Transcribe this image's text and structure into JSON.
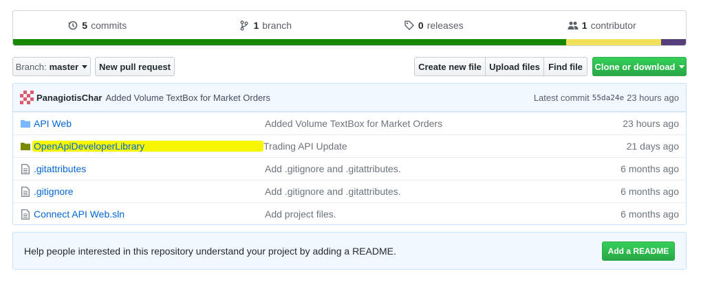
{
  "summary": {
    "commits": {
      "count": "5",
      "label": "commits",
      "icon": "history-icon"
    },
    "branches": {
      "count": "1",
      "label": "branch",
      "icon": "branch-icon"
    },
    "releases": {
      "count": "0",
      "label": "releases",
      "icon": "tag-icon"
    },
    "contributors": {
      "count": "1",
      "label": "contributor",
      "icon": "people-icon"
    },
    "language_colors": [
      "#178600",
      "#f1e05a",
      "#563d7c"
    ],
    "language_shares": [
      0.822,
      0.141,
      0.037
    ]
  },
  "toolbar": {
    "branch_prefix": "Branch:",
    "branch_name": "master",
    "new_pr_label": "New pull request",
    "create_file_label": "Create new file",
    "upload_files_label": "Upload files",
    "find_file_label": "Find file",
    "clone_label": "Clone or download"
  },
  "latest_commit": {
    "author": "PanagiotisChar",
    "message": "Added Volume TextBox for Market Orders",
    "prefix": "Latest commit",
    "sha": "55da24e",
    "age": "23 hours ago"
  },
  "files": [
    {
      "type": "dir",
      "name": "API Web",
      "message": "Added Volume TextBox for Market Orders",
      "age": "23 hours ago"
    },
    {
      "type": "dir",
      "name": "OpenApiDeveloperLibrary",
      "message": "Trading API Update",
      "age": "21 days ago",
      "highlighted": true
    },
    {
      "type": "file",
      "name": ".gitattributes",
      "message": "Add .gitignore and .gitattributes.",
      "age": "6 months ago"
    },
    {
      "type": "file",
      "name": ".gitignore",
      "message": "Add .gitignore and .gitattributes.",
      "age": "6 months ago"
    },
    {
      "type": "file",
      "name": "Connect API Web.sln",
      "message": "Add project files.",
      "age": "6 months ago"
    }
  ],
  "readme_banner": {
    "text": "Help people interested in this repository understand your project by adding a README.",
    "button_label": "Add a README"
  },
  "colors": {
    "link": "#0366d6",
    "green": "#28a745",
    "highlight": "#f6f600",
    "folder": "#79b8ff"
  }
}
